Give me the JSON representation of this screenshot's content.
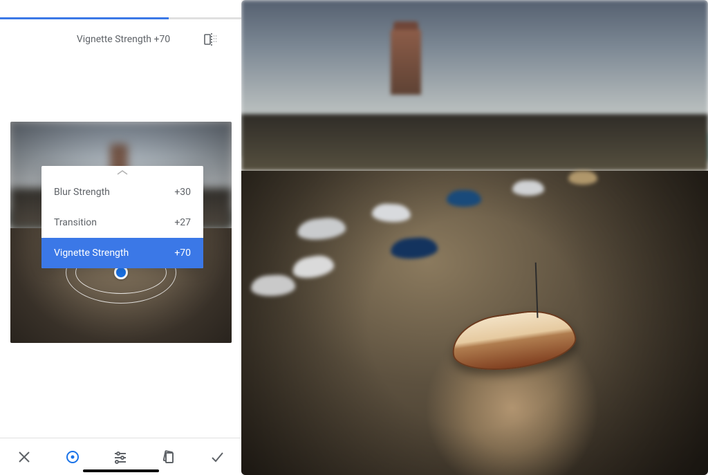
{
  "header": {
    "title": "Vignette Strength +70"
  },
  "slider": {
    "value": 70,
    "max": 100
  },
  "params": [
    {
      "label": "Blur Strength",
      "value": "+30",
      "active": false
    },
    {
      "label": "Transition",
      "value": "+27",
      "active": false
    },
    {
      "label": "Vignette Strength",
      "value": "+70",
      "active": true
    }
  ],
  "toolbar": {
    "close": "close-icon",
    "focus": "focus-point-icon",
    "adjust": "sliders-icon",
    "styles": "styles-icon",
    "apply": "checkmark-icon"
  }
}
